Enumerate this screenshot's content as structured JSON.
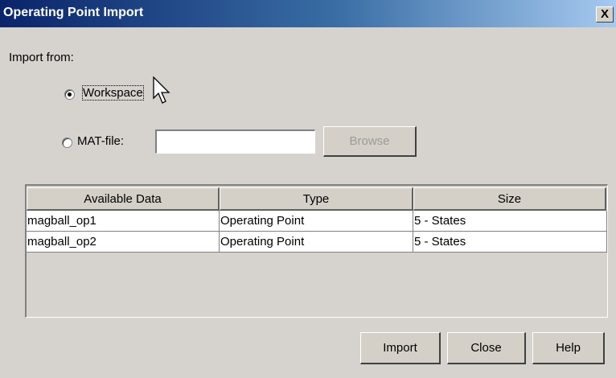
{
  "window": {
    "title": "Operating Point Import",
    "close_glyph": "X"
  },
  "import_from_label": "Import from:",
  "options": {
    "workspace": {
      "label": "Workspace",
      "selected": true
    },
    "matfile": {
      "label": "MAT-file:",
      "selected": false,
      "value": ""
    }
  },
  "browse_label": "Browse",
  "table": {
    "headers": [
      "Available Data",
      "Type",
      "Size"
    ],
    "rows": [
      [
        "magball_op1",
        "Operating Point",
        "5 - States"
      ],
      [
        "magball_op2",
        "Operating Point",
        "5 - States"
      ]
    ]
  },
  "buttons": {
    "import": "Import",
    "close": "Close",
    "help": "Help"
  }
}
